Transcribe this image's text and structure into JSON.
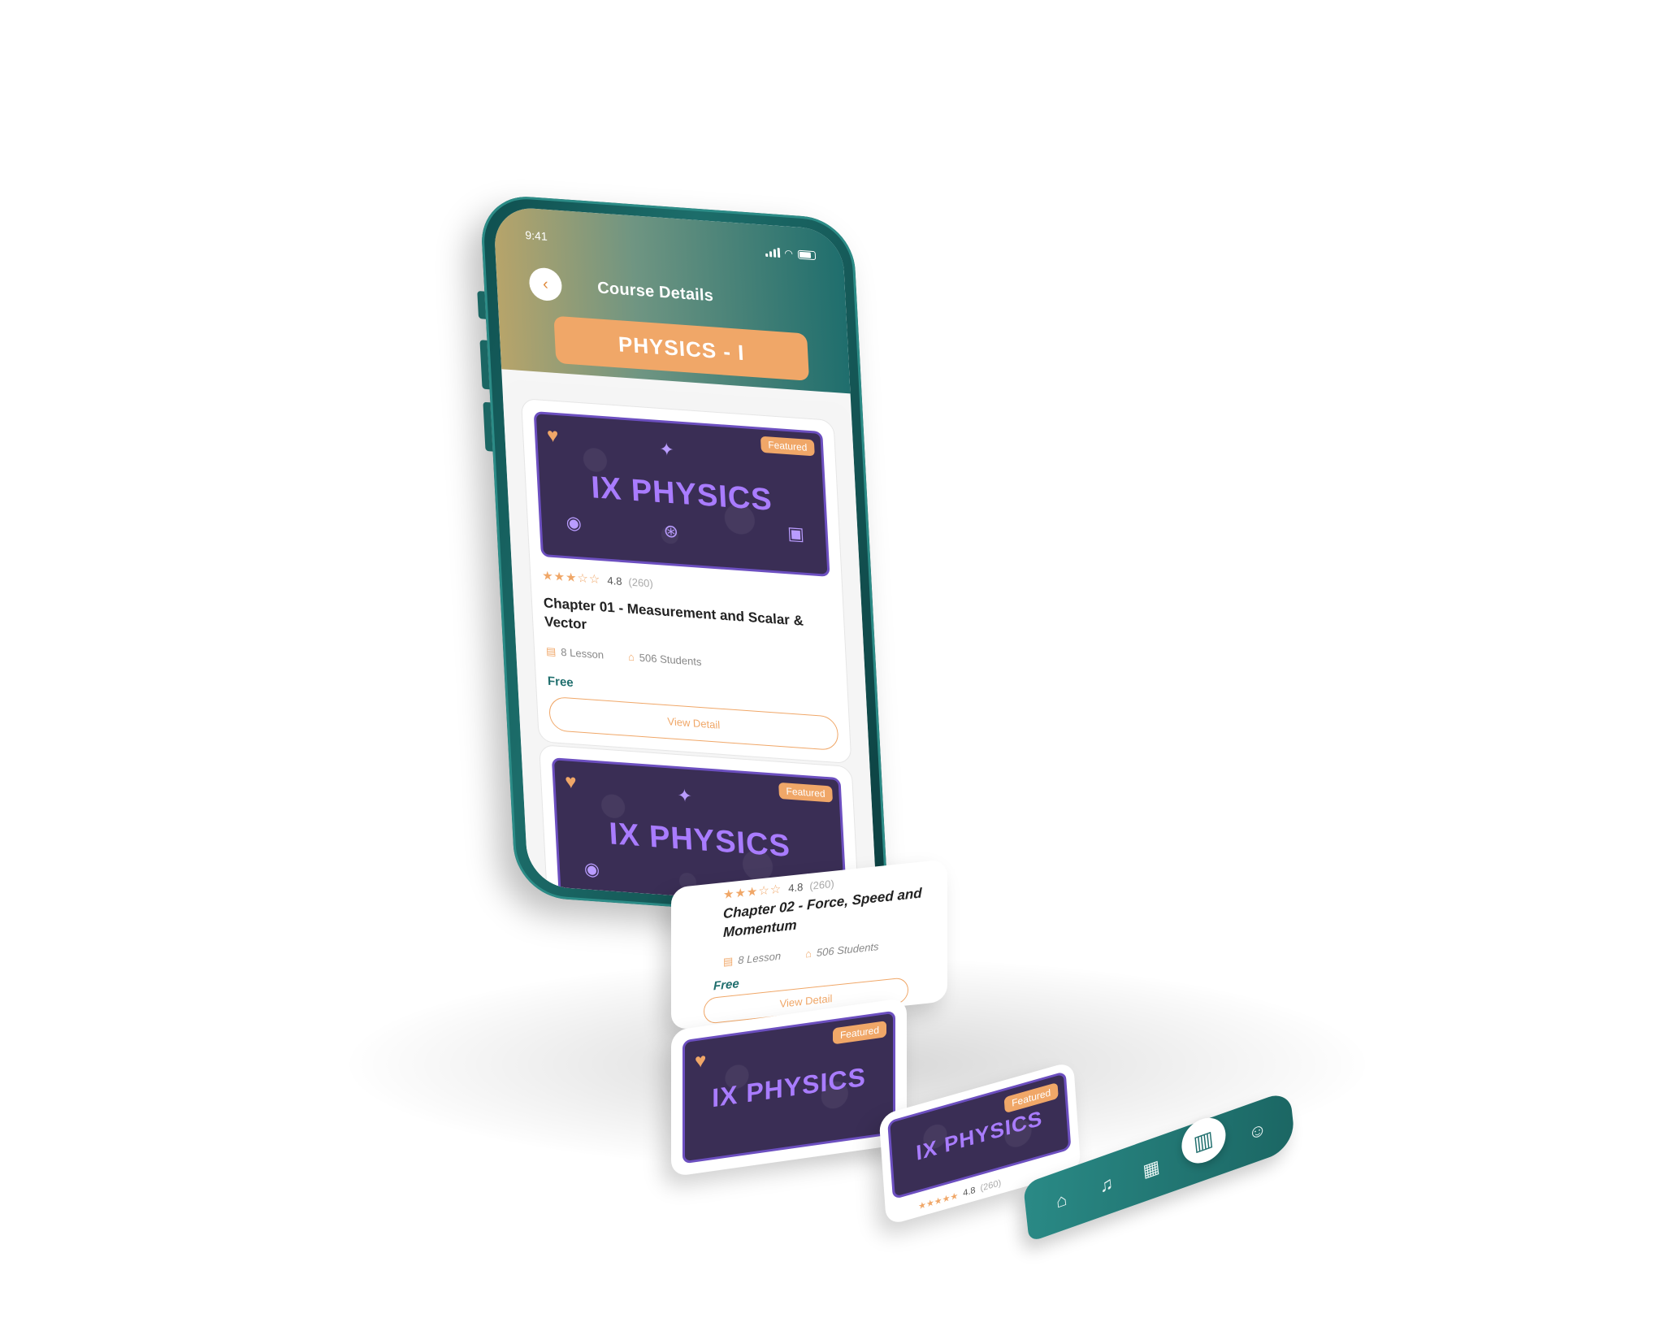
{
  "status_bar": {
    "time": "9:41"
  },
  "header": {
    "back_icon": "chevron-left-icon",
    "title": "Course Details",
    "subject": "PHYSICS - I"
  },
  "courses": [
    {
      "thumbnail_text": "IX PHYSICS",
      "badge": "Featured",
      "rating": "4.8",
      "rating_count": "(260)",
      "stars": "★★★☆☆",
      "title": "Chapter 01 - Measurement and Scalar & Vector",
      "lessons": "8 Lesson",
      "students": "506 Students",
      "price": "Free",
      "button": "View Detail"
    },
    {
      "thumbnail_text": "IX PHYSICS",
      "badge": "Featured",
      "rating": "4.8",
      "rating_count": "(260)",
      "stars": "★★★☆☆",
      "title": "Chapter 02 - Force, Speed and Momentum",
      "lessons": "8 Lesson",
      "students": "506 Students",
      "price": "Free",
      "button": "View Detail"
    },
    {
      "thumbnail_text": "IX PHYSICS",
      "badge": "Featured"
    },
    {
      "thumbnail_text": "IX PHYSICS",
      "badge": "Featured",
      "rating": "4.8",
      "rating_count": "(260)"
    }
  ],
  "tab_bar": {
    "items": [
      "home-icon",
      "bell-icon",
      "calendar-icon",
      "book-icon",
      "profile-icon"
    ],
    "active_index": 3
  },
  "colors": {
    "accent_orange": "#f0a768",
    "brand_teal": "#1f6e6d",
    "thumbnail_purple": "#6c4fc0"
  }
}
